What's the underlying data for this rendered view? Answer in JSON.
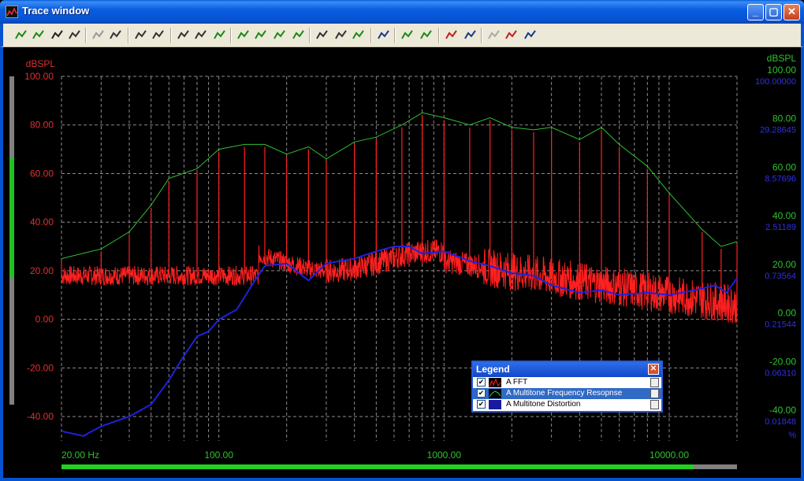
{
  "window": {
    "title": "Trace window"
  },
  "titlebar_buttons": [
    "minimize",
    "maximize",
    "close"
  ],
  "toolbar": {
    "icons": [
      "add-trace-icon",
      "curve-icon",
      "save-icon",
      "copy-icon",
      "disabled-chart-icon",
      "export-icon",
      "edit-icon",
      "numeric-icon",
      "zoom-x-icon",
      "zoom-y-icon",
      "autoscale-icon",
      "peak-up-icon",
      "peak-right-icon",
      "peak-left-icon",
      "peak-down-icon",
      "cursor-left-icon",
      "cursor-right-icon",
      "wave-icon",
      "scale-icon",
      "marker-up-icon",
      "marker-down-icon",
      "db-icon",
      "arrows-icon",
      "disabled-marker-icon",
      "compare-icon",
      "tune-icon"
    ]
  },
  "chart_data": {
    "type": "line",
    "left_axis": {
      "label": "dBSPL",
      "ticks": [
        "100.00",
        "80.00",
        "60.00",
        "40.00",
        "20.00",
        "0.00",
        "-20.00",
        "-40.00"
      ],
      "ylim": [
        -50,
        100
      ]
    },
    "right_axis_green": {
      "label": "dBSPL",
      "ticks": [
        "100.00",
        "80.00",
        "60.00",
        "40.00",
        "20.00",
        "0.00",
        "-20.00",
        "-40.00"
      ]
    },
    "right_axis_blue": {
      "unit": "%",
      "ticks": [
        "100.00000",
        "29.28645",
        "8.57696",
        "2.51189",
        "0.73564",
        "0.21544",
        "0.06310",
        "0.01848"
      ]
    },
    "x_axis": {
      "scale": "log",
      "tick_labels": [
        "20.00 Hz",
        "100.00",
        "1000.00",
        "10000.00"
      ],
      "xlim": [
        20,
        20000
      ]
    },
    "series": [
      {
        "name": "A  FFT",
        "color": "#ff2020"
      },
      {
        "name": "A  Multitone Frequency Resopnse",
        "color": "#30c030",
        "x": [
          20,
          30,
          40,
          50,
          60,
          80,
          100,
          130,
          160,
          200,
          250,
          300,
          400,
          500,
          650,
          800,
          1000,
          1300,
          1600,
          2000,
          2500,
          3000,
          4000,
          5000,
          6000,
          8000,
          10000,
          14000,
          17000,
          20000
        ],
        "y": [
          25,
          29,
          36,
          47,
          58,
          62,
          70,
          72,
          72,
          68,
          71,
          66,
          73,
          75,
          80,
          85,
          83,
          80,
          83,
          79,
          78,
          79,
          74,
          79,
          72,
          63,
          52,
          37,
          30,
          32
        ]
      },
      {
        "name": "A  Multitone Distortion",
        "color": "#2020e0",
        "x": [
          20,
          25,
          30,
          40,
          50,
          60,
          70,
          80,
          90,
          100,
          120,
          140,
          160,
          200,
          250,
          300,
          400,
          500,
          600,
          700,
          800,
          1000,
          1300,
          1600,
          2000,
          2500,
          3000,
          4000,
          5000,
          6000,
          8000,
          10000,
          13000,
          16000,
          18000,
          20000
        ],
        "y": [
          -46,
          -48,
          -44,
          -40,
          -35,
          -25,
          -15,
          -7,
          -5,
          0,
          4,
          14,
          22,
          23,
          16,
          23,
          25,
          28,
          30,
          30,
          27,
          28,
          24,
          22,
          19,
          18,
          14,
          11,
          12,
          10,
          11,
          10,
          12,
          14,
          11,
          17
        ]
      }
    ]
  },
  "legend": {
    "title": "Legend",
    "items": [
      {
        "label": "A  FFT",
        "checked": true,
        "selected": false
      },
      {
        "label": "A  Multitone Frequency Resopnse",
        "checked": true,
        "selected": true
      },
      {
        "label": "A  Multitone Distortion",
        "checked": true,
        "selected": false
      }
    ]
  }
}
